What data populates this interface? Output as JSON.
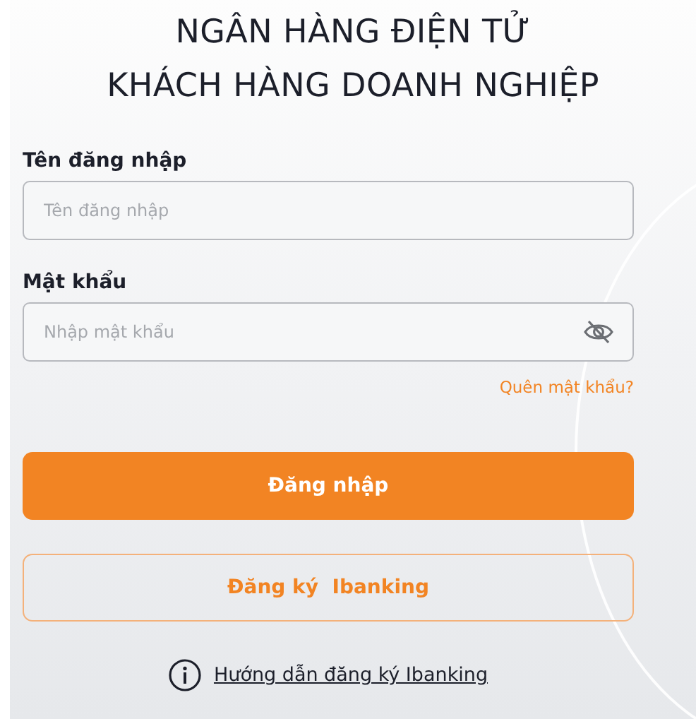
{
  "title_lines": [
    "NGÂN HÀNG ĐIỆN TỬ",
    "KHÁCH HÀNG DOANH NGHIỆP"
  ],
  "fields": [
    {
      "label": "Tên đăng nhập",
      "placeholder": "Tên đăng nhập",
      "kind": "text"
    },
    {
      "label": "Mật khẩu",
      "placeholder": "Nhập mật khẩu",
      "kind": "password"
    }
  ],
  "forgot_link": "Quên mật khẩu?",
  "login_button": "Đăng nhập",
  "register_button": "Đăng ký  Ibanking",
  "help_link": "Hướng dẫn đăng ký Ibanking"
}
